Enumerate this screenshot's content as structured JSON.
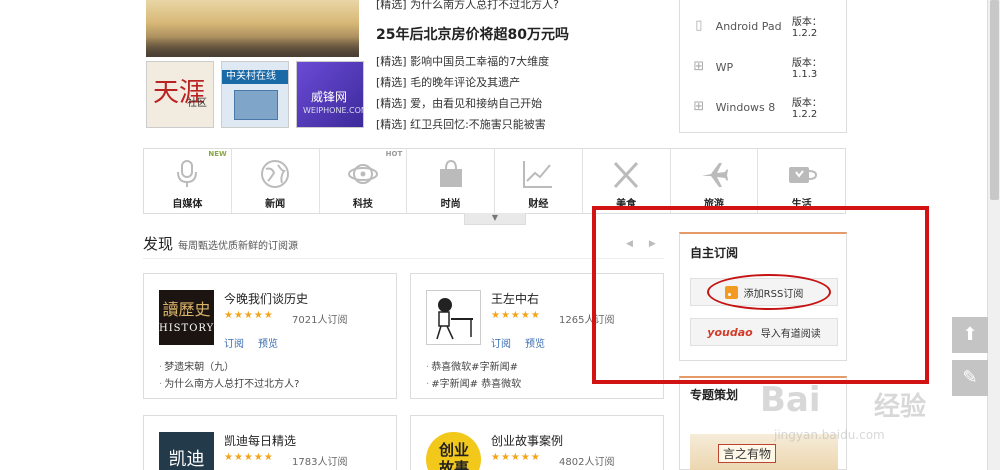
{
  "top_news": {
    "clipped_item": "[精选] 为什么南方人总打不过北方人?",
    "headline": "25年后北京房价将超80万元吗",
    "items": [
      "[精选] 影响中国员工幸福的7大维度",
      "[精选] 毛的晚年评论及其遗产",
      "[精选] 爱，由看见和接纳自己开始",
      "[精选] 红卫兵回忆:不施害只能被害"
    ]
  },
  "thumbnails": {
    "tianya": {
      "big": "天涯",
      "label": "社区"
    },
    "zol": {
      "label": "中关村在线"
    },
    "weiphone": {
      "label": "威锋网",
      "sub": "WEIPHONE.COM"
    }
  },
  "platforms": [
    {
      "name": "Android Pad",
      "version": "版本：1.2.2"
    },
    {
      "name": "WP",
      "version": "版本：1.1.3"
    },
    {
      "name": "Windows 8",
      "version": "版本：1.2.2"
    }
  ],
  "categories": [
    {
      "label": "自媒体",
      "badge": "NEW"
    },
    {
      "label": "新闻",
      "badge": ""
    },
    {
      "label": "科技",
      "badge": "HOT"
    },
    {
      "label": "时尚",
      "badge": ""
    },
    {
      "label": "财经",
      "badge": ""
    },
    {
      "label": "美食",
      "badge": ""
    },
    {
      "label": "旅游",
      "badge": ""
    },
    {
      "label": "生活",
      "badge": ""
    }
  ],
  "discover": {
    "title": "发现",
    "subtitle": "每周甄选优质新鲜的订阅源",
    "prev": "◀",
    "next": "▶"
  },
  "cards": [
    {
      "name": "今晚我们谈历史",
      "stars": "★★★★★",
      "subs": "7021人订阅",
      "subscribe": "订阅",
      "preview": "预览",
      "logo_l1": "讀歷史",
      "logo_l2": "HISTORY",
      "items": [
        "梦遗宋朝（九）",
        "为什么南方人总打不过北方人?"
      ]
    },
    {
      "name": "王左中右",
      "stars": "★★★★★",
      "subs": "1265人订阅",
      "subscribe": "订阅",
      "preview": "预览",
      "items": [
        "恭喜微软#字新闻#",
        "#字新闻# 恭喜微软"
      ]
    },
    {
      "name": "凯迪每日精选",
      "stars": "★★★★★",
      "subs": "1783人订阅",
      "logo_text": "凯迪"
    },
    {
      "name": "创业故事案例",
      "stars": "★★★★★",
      "subs": "4802人订阅",
      "logo_text": "创业故事"
    }
  ],
  "sidebar": {
    "subscribe_title": "自主订阅",
    "rss_button": "添加RSS订阅",
    "youdao_logo": "youdao",
    "youdao_button": "导入有道阅读",
    "topics_title": "专题策划",
    "banner_text": "言之有物"
  },
  "floating": {
    "top": "⬆",
    "edit": "✎"
  },
  "watermark": {
    "line1": "Bai",
    "line1b": "经验",
    "line2": "jingyan.baidu.com"
  },
  "colors": {
    "accent_blue": "#3a6db3",
    "star": "#f3a41a",
    "annotation_red": "#d21313",
    "section_border": "#e59a67"
  }
}
